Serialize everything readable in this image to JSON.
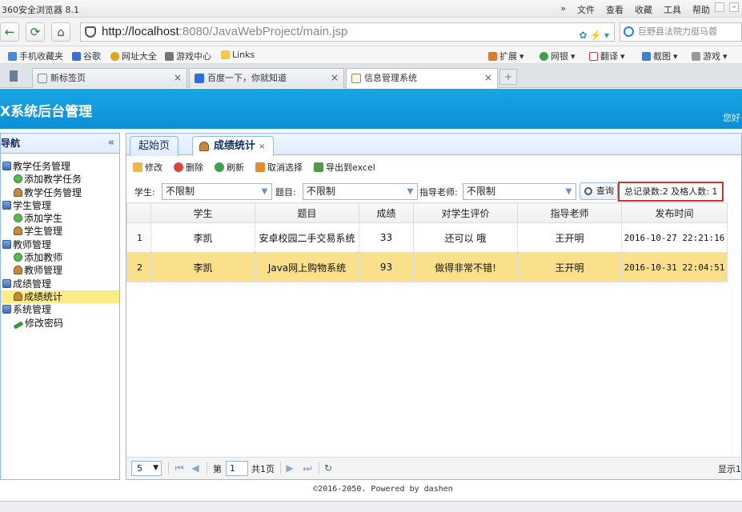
{
  "browser": {
    "window_title": "360安全浏览器 8.1",
    "menu": [
      "»",
      "文件",
      "查看",
      "收藏",
      "工具",
      "帮助"
    ],
    "url_host": "http://localhost",
    "url_rest": ":8080/JavaWebProject/main.jsp",
    "search_text": "巨野县法院力挺马蓉",
    "bookmarks": [
      "手机收藏夹",
      "谷歌",
      "网址大全",
      "游戏中心",
      "Links"
    ],
    "extensions": [
      "扩展",
      "网银",
      "翻译",
      "截图",
      "游戏"
    ],
    "tabs": [
      {
        "label": "新标签页",
        "active": false
      },
      {
        "label": "百度一下，你就知道",
        "active": false
      },
      {
        "label": "信息管理系统",
        "active": true
      }
    ],
    "new_tab": "+"
  },
  "app": {
    "title": "X系统后台管理",
    "greeting": "您好",
    "west_title": "导航",
    "west_collapse": "«",
    "tree": [
      {
        "label": "教学任务管理",
        "level": 0,
        "icon": "folder-icon"
      },
      {
        "label": "添加教学任务",
        "level": 1,
        "icon": "add-icon"
      },
      {
        "label": "教学任务管理",
        "level": 1,
        "icon": "user-icon"
      },
      {
        "label": "学生管理",
        "level": 0,
        "icon": "folder-icon"
      },
      {
        "label": "添加学生",
        "level": 1,
        "icon": "add-icon"
      },
      {
        "label": "学生管理",
        "level": 1,
        "icon": "user-icon"
      },
      {
        "label": "教师管理",
        "level": 0,
        "icon": "folder-icon"
      },
      {
        "label": "添加教师",
        "level": 1,
        "icon": "add-icon"
      },
      {
        "label": "教师管理",
        "level": 1,
        "icon": "user-icon"
      },
      {
        "label": "成绩管理",
        "level": 0,
        "icon": "folder-icon"
      },
      {
        "label": "成绩统计",
        "level": 1,
        "icon": "user-icon",
        "selected": true
      },
      {
        "label": "系统管理",
        "level": 0,
        "icon": "folder-icon"
      },
      {
        "label": "修改密码",
        "level": 1,
        "icon": "pencil-icon"
      }
    ],
    "center_tabs": [
      {
        "label": "起始页",
        "active": false
      },
      {
        "label": "成绩统计",
        "active": true,
        "close": "×"
      }
    ],
    "toolbar": [
      "修改",
      "删除",
      "刷新",
      "取消选择",
      "导出到excel"
    ],
    "filters": {
      "student_label": "学生:",
      "student_value": "不限制",
      "topic_label": "题目:",
      "topic_value": "不限制",
      "teacher_label": "指导老师:",
      "teacher_value": "不限制",
      "query_label": "查询"
    },
    "stats_text": "总记录数:2 及格人数: 1",
    "grid": {
      "columns": [
        "学生",
        "题目",
        "成绩",
        "对学生评价",
        "指导老师",
        "发布时间"
      ],
      "rows": [
        {
          "rn": "1",
          "student": "李凯",
          "topic": "安卓校园二手交易系统",
          "score": "33",
          "comment": "还可以 哦",
          "teacher": "王开明",
          "time": "2016-10-27 22:21:16",
          "selected": false
        },
        {
          "rn": "2",
          "student": "李凯",
          "topic": "Java网上购物系统",
          "score": "93",
          "comment": "做得非常不错!",
          "teacher": "王开明",
          "time": "2016-10-31 22:04:51",
          "selected": true
        }
      ]
    },
    "pager": {
      "page_size": "5",
      "page_prefix": "第",
      "page_number": "1",
      "page_total": "共1页",
      "display": "显示1"
    },
    "footer": "©2016-2050. Powered by dashen"
  }
}
